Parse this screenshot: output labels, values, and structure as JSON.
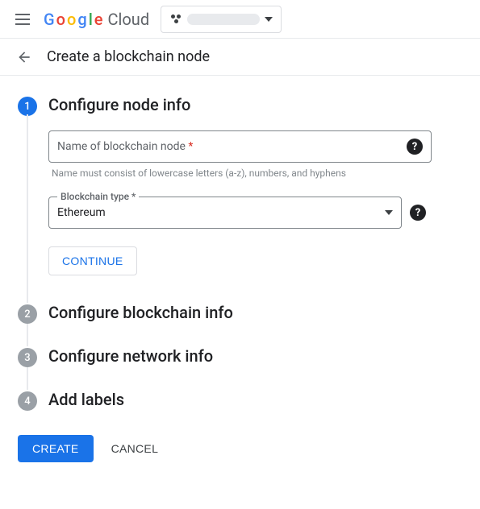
{
  "header": {
    "brand": "Google",
    "brand_suffix": "Cloud"
  },
  "page": {
    "title": "Create a blockchain node"
  },
  "steps": [
    {
      "number": "1",
      "title": "Configure node info",
      "active": true
    },
    {
      "number": "2",
      "title": "Configure blockchain info",
      "active": false
    },
    {
      "number": "3",
      "title": "Configure network info",
      "active": false
    },
    {
      "number": "4",
      "title": "Add labels",
      "active": false
    }
  ],
  "form": {
    "name_field": {
      "placeholder": "Name of blockchain node",
      "required_marker": "*",
      "value": "",
      "hint": "Name must consist of lowercase letters (a-z), numbers, and hyphens"
    },
    "type_field": {
      "label": "Blockchain type",
      "required_marker": "*",
      "value": "Ethereum"
    },
    "continue_label": "CONTINUE"
  },
  "footer": {
    "create_label": "CREATE",
    "cancel_label": "CANCEL"
  }
}
